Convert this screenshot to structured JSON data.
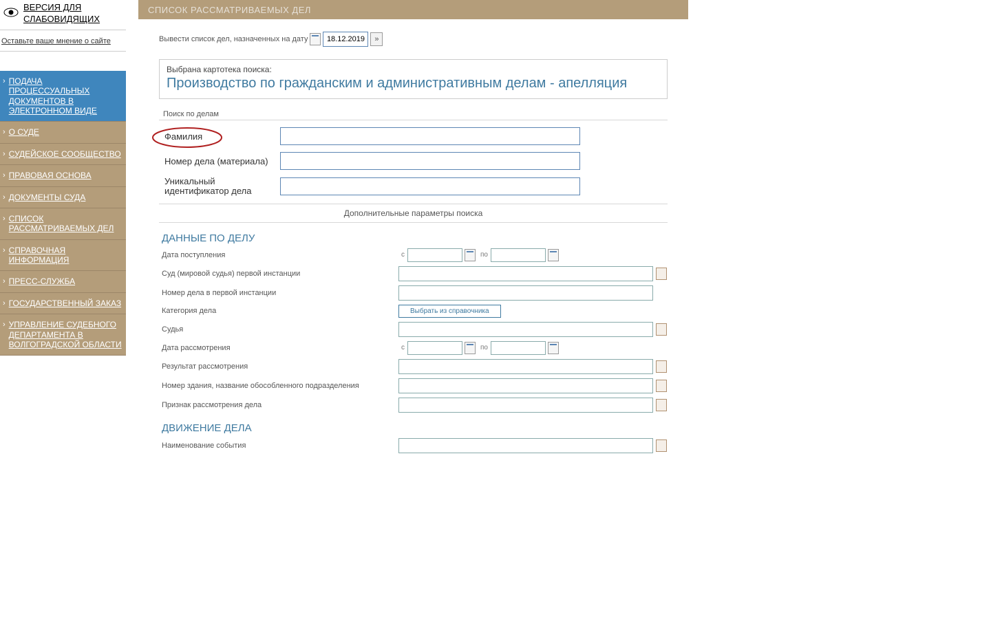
{
  "accessibility": {
    "label": "ВЕРСИЯ ДЛЯ СЛАБОВИДЯЩИХ"
  },
  "feedback": {
    "label": "Оставьте ваше мнение о сайте"
  },
  "sidebar": {
    "items": [
      {
        "label": "ПОДАЧА ПРОЦЕССУАЛЬНЫХ ДОКУМЕНТОВ В ЭЛЕКТРОННОМ ВИДЕ"
      },
      {
        "label": "О СУДЕ"
      },
      {
        "label": "СУДЕЙСКОЕ СООБЩЕСТВО"
      },
      {
        "label": "ПРАВОВАЯ ОСНОВА"
      },
      {
        "label": "ДОКУМЕНТЫ СУДА"
      },
      {
        "label": "СПИСОК РАССМАТРИВАЕМЫХ ДЕЛ"
      },
      {
        "label": "СПРАВОЧНАЯ ИНФОРМАЦИЯ"
      },
      {
        "label": "ПРЕСС-СЛУЖБА"
      },
      {
        "label": "ГОСУДАРСТВЕННЫЙ ЗАКАЗ"
      },
      {
        "label": "УПРАВЛЕНИЕ СУДЕБНОГО ДЕПАРТАМЕНТА В ВОЛГОГРАДСКОЙ ОБЛАСТИ"
      }
    ]
  },
  "title": "СПИСОК РАССМАТРИВАЕМЫХ ДЕЛ",
  "date_row": {
    "prefix": "Вывести список дел, назначенных на дату",
    "value": "18.12.2019",
    "go": "»"
  },
  "search": {
    "selected_label": "Выбрана картотека поиска:",
    "title": "Производство по гражданским и административным делам - апелляция",
    "fieldset": "Поиск по делам",
    "fields": [
      {
        "label": "Фамилия"
      },
      {
        "label": "Номер дела (материала)"
      },
      {
        "label": "Уникальный идентификатор дела"
      }
    ]
  },
  "adv_header": "Дополнительные параметры поиска",
  "section_case": {
    "title": "ДАННЫЕ ПО ДЕЛУ",
    "date_received": "Дата поступления",
    "from": "с",
    "to": "по",
    "court_first": "Суд (мировой судья) первой инстанции",
    "case_no_first": "Номер дела в первой инстанции",
    "category": "Категория дела",
    "ref_btn": "Выбрать из справочника",
    "judge": "Судья",
    "date_hearing": "Дата рассмотрения",
    "result": "Результат рассмотрения",
    "building": "Номер здания, название обособленного подразделения",
    "sign": "Признак рассмотрения дела"
  },
  "section_move": {
    "title": "ДВИЖЕНИЕ ДЕЛА",
    "event": "Наименование события"
  }
}
